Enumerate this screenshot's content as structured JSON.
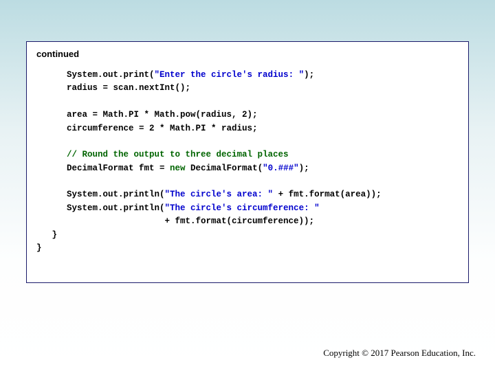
{
  "header": "continued",
  "code": {
    "l1a": "System.out.print(",
    "l1b": "\"Enter the circle's radius: \"",
    "l1c": ");",
    "l2": "radius = scan.nextInt();",
    "l3": "area = Math.PI * Math.pow(radius, 2);",
    "l4": "circumference = 2 * Math.PI * radius;",
    "l5": "// Round the output to three decimal places",
    "l6a": "DecimalFormat fmt = ",
    "l6kw": "new",
    "l6b": " DecimalFormat(",
    "l6c": "\"0.###\"",
    "l6d": ");",
    "l7a": "System.out.println(",
    "l7b": "\"The circle's area: \"",
    "l7c": " + fmt.format(area));",
    "l8a": "System.out.println(",
    "l8b": "\"The circle's circumference: \"",
    "l9a": "                   + fmt.format(circumference));"
  },
  "closers": {
    "inner": "   }",
    "outer": "}"
  },
  "footer": "Copyright © 2017 Pearson Education, Inc."
}
